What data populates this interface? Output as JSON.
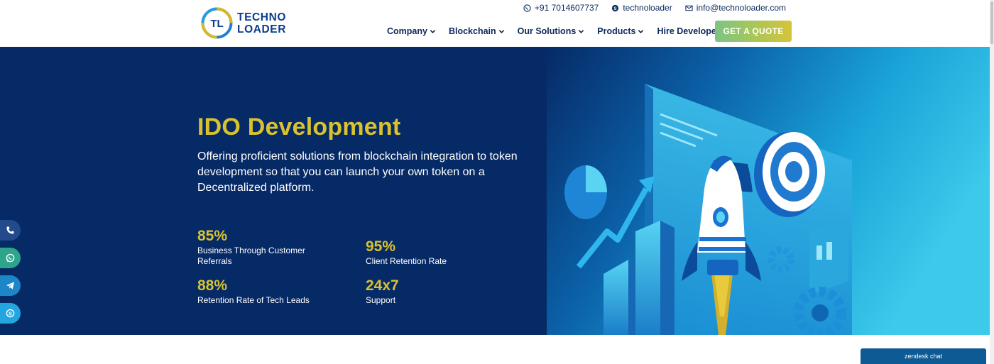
{
  "brand": {
    "line1": "TECHNO",
    "line2": "LOADER",
    "mark": "TL"
  },
  "contact": {
    "phone": "+91 7014607737",
    "skype": "technoloader",
    "email": "info@technoloader.com"
  },
  "nav": {
    "items": [
      "Company",
      "Blockchain",
      "Our Solutions",
      "Products",
      "Hire Developer"
    ],
    "cta": "GET A QUOTE"
  },
  "hero": {
    "title": "IDO Development",
    "description": "Offering proficient solutions from blockchain integration to token development so that you can launch your own token on a Decentralized platform.",
    "stats": [
      {
        "value": "85%",
        "label": "Business Through Customer Referrals"
      },
      {
        "value": "95%",
        "label": "Client Retention Rate"
      },
      {
        "value": "88%",
        "label": "Retention Rate of Tech Leads"
      },
      {
        "value": "24x7",
        "label": "Support"
      }
    ]
  },
  "social": [
    "phone-icon",
    "whatsapp-icon",
    "telegram-icon",
    "skype-icon"
  ],
  "zendesk": {
    "label": "zendesk chat"
  },
  "colors": {
    "navy": "#062a66",
    "gold": "#d9c22e",
    "cyan": "#36c6e8",
    "text_dark": "#0b2a5c"
  }
}
